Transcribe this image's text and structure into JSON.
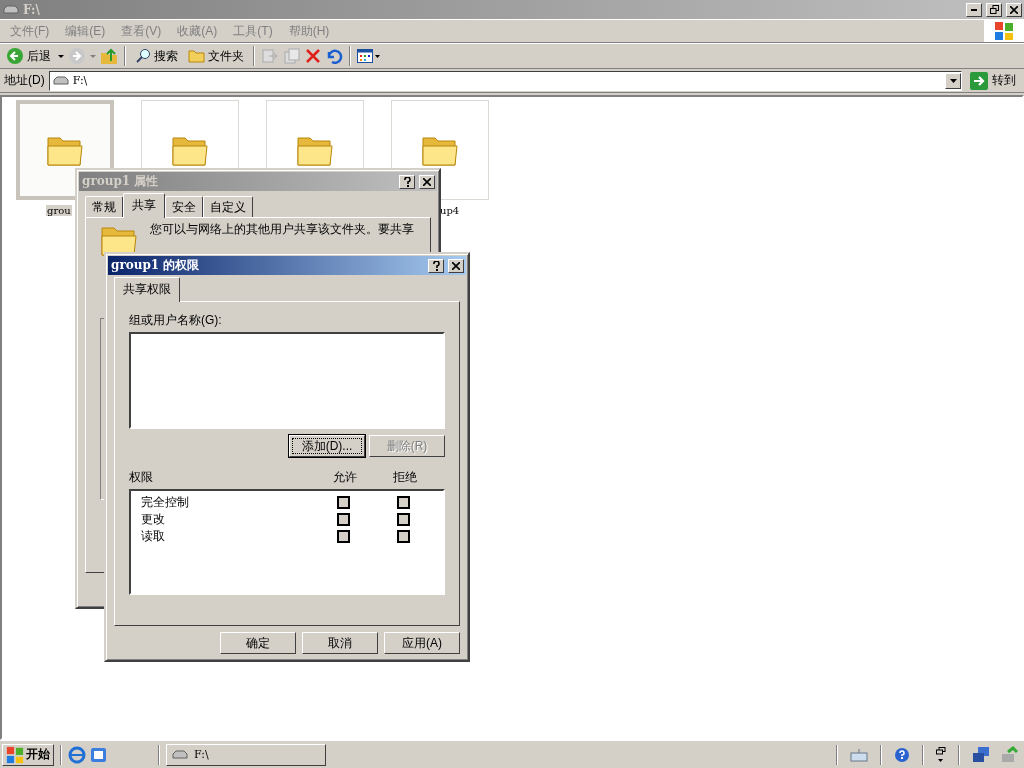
{
  "window": {
    "title": "F:\\"
  },
  "menu": [
    {
      "label": "文件(F)"
    },
    {
      "label": "编辑(E)"
    },
    {
      "label": "查看(V)"
    },
    {
      "label": "收藏(A)"
    },
    {
      "label": "工具(T)"
    },
    {
      "label": "帮助(H)"
    }
  ],
  "toolbar": {
    "back": "后退",
    "search": "搜索",
    "folders": "文件夹"
  },
  "address": {
    "label": "地址(D)",
    "value": "F:\\",
    "go": "转到"
  },
  "folders": [
    {
      "label": "grou",
      "selected": true
    },
    {
      "selected": false
    },
    {
      "selected": false
    },
    {
      "label": "up4",
      "selected": false
    }
  ],
  "properties_dialog": {
    "title": "group1 属性",
    "tabs": [
      {
        "label": "常规",
        "selected": false
      },
      {
        "label": "共享",
        "selected": true
      },
      {
        "label": "安全",
        "selected": false
      },
      {
        "label": "自定义",
        "selected": false
      }
    ],
    "text": "您可以与网络上的其他用户共享该文件夹。要共享"
  },
  "permissions_dialog": {
    "title": "group1 的权限",
    "tabs": [
      {
        "label": "共享权限",
        "selected": true
      }
    ],
    "users_label": "组或用户名称(G):",
    "add_button": {
      "label": "添加(D)...",
      "disabled": false
    },
    "remove_button": {
      "label": "删除(R)",
      "disabled": true
    },
    "columns": [
      "权限",
      "允许",
      "拒绝"
    ],
    "permissions": [
      {
        "name": "完全控制",
        "allow": false,
        "deny": false
      },
      {
        "name": "更改",
        "allow": false,
        "deny": false
      },
      {
        "name": "读取",
        "allow": false,
        "deny": false
      }
    ],
    "buttons": [
      "确定",
      "取消",
      "应用(A)"
    ]
  },
  "taskbar": {
    "start": "开始",
    "tasks": [
      {
        "label": "F:\\"
      }
    ]
  }
}
